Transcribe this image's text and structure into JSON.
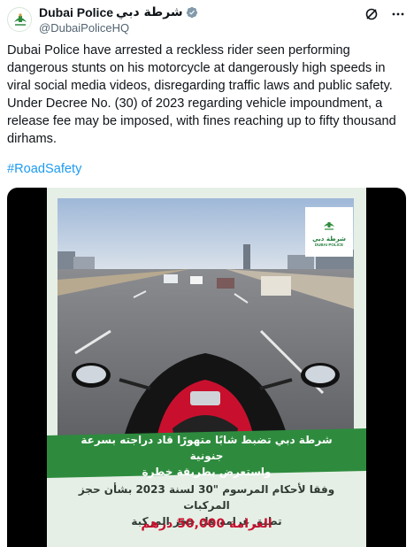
{
  "account": {
    "display_name": "Dubai Police",
    "display_name_ar": "شرطة دبي",
    "handle": "@DubaiPoliceHQ",
    "verified_color": "#829aab"
  },
  "header_icons": [
    "grok-icon",
    "more-options-icon"
  ],
  "tweet": {
    "line1": "Dubai Police have arrested a reckless rider seen performing dangerous stunts on his motorcycle at dangerously high speeds in viral social media videos, disregarding traffic laws and public safety.",
    "line2": "Under Decree No. (30) of 2023 regarding vehicle impoundment, a release fee may be imposed, with fines reaching up to fifty thousand dirhams.",
    "hashtag": "#RoadSafety"
  },
  "video": {
    "logo_ar": "شرطة دبي",
    "logo_en": "DUBAI POLICE",
    "banner_line1": "شرطة دبي تضبط شابًا متهورًا قاد دراجته بسرعة جنونية",
    "banner_line2": "واستعرض بطريقة خطرة",
    "decree_line1": "وفقا لأحكام المرسوم \"30 لسنة 2023 بشأن حجز المركبات",
    "decree_line2": "تطبق غرامة فك حجز المركبة",
    "fine_line": "الغرامة 50,000 درهم",
    "colors": {
      "banner": "#2e8b3e",
      "fine": "#c8102e",
      "frame": "#e6efe6"
    }
  }
}
